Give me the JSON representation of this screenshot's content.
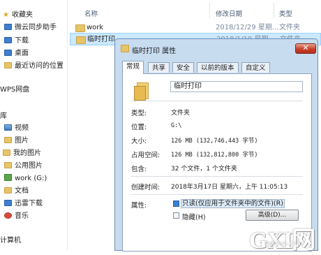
{
  "sidebar": {
    "sections": [
      {
        "label": "收藏夹",
        "icon": "star-icon"
      },
      {
        "label": "微云同步助手",
        "icon": "cloud-sync-icon"
      },
      {
        "label": "下载",
        "icon": "download-folder-icon"
      },
      {
        "label": "桌面",
        "icon": "desktop-icon"
      },
      {
        "label": "最近访问的位置",
        "icon": "recent-places-icon"
      },
      {
        "label": "WPS网盘",
        "icon": "wps-cloud-icon"
      },
      {
        "label": "库",
        "icon": "library-icon"
      },
      {
        "label": "视频",
        "icon": "video-library-icon"
      },
      {
        "label": "图片",
        "icon": "pictures-library-icon"
      },
      {
        "label": "我的图片",
        "icon": "my-pictures-icon"
      },
      {
        "label": "公用图片",
        "icon": "public-pictures-icon"
      },
      {
        "label": "work (G:)",
        "icon": "drive-icon"
      },
      {
        "label": "文档",
        "icon": "documents-library-icon"
      },
      {
        "label": "迅雷下载",
        "icon": "thunder-download-icon"
      },
      {
        "label": "音乐",
        "icon": "music-library-icon"
      },
      {
        "label": "计算机",
        "icon": "computer-icon"
      }
    ]
  },
  "file_list": {
    "headers": {
      "name": "名称",
      "date": "修改日期",
      "type": "类型"
    },
    "rows": [
      {
        "name": "work",
        "date": "2018/12/29 星期...",
        "type": "文件夹"
      },
      {
        "name": "临时打印",
        "date": "2018/1/19 星期...",
        "type": "文件夹"
      }
    ]
  },
  "dialog": {
    "title": "临时打印 属性",
    "close_symbol": "✕",
    "tabs": [
      "常规",
      "共享",
      "安全",
      "以前的版本",
      "自定义"
    ],
    "folder_name": "临时打印",
    "properties": [
      {
        "label": "类型:",
        "value": "文件夹"
      },
      {
        "label": "位置:",
        "value": "G:\\"
      },
      {
        "label": "大小:",
        "value": "126 MB (132,746,443 字节)"
      },
      {
        "label": "占用空间:",
        "value": "126 MB (132,812,800 字节)"
      },
      {
        "label": "包含:",
        "value": "32 个文件，1 个文件夹"
      },
      {
        "label": "创建时间:",
        "value": "2018年3月17日 星期六，上午 11:05:13"
      }
    ],
    "attributes_label": "属性:",
    "readonly_label": "只读(仅应用于文件夹中的文件)(R)",
    "readonly_checked": true,
    "hidden_label": "隐藏(H)",
    "hidden_checked": false,
    "advanced_button": "高级(D)..."
  },
  "watermark": {
    "logo": "GXI网",
    "sub": "system.com"
  }
}
